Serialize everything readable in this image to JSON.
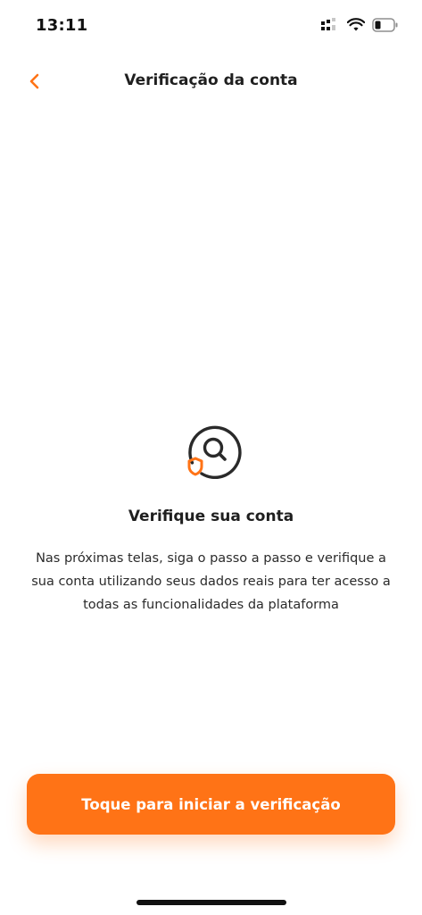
{
  "status_bar": {
    "time": "13:11",
    "icons": [
      "signal-icon",
      "wifi-icon",
      "battery-icon"
    ]
  },
  "header": {
    "title": "Verificação da conta",
    "back_icon": "chevron-left-icon"
  },
  "main": {
    "icon": "shield-search-icon",
    "title": "Verifique sua conta",
    "description": "Nas próximas telas, siga o passo a passo e verifique a sua conta utilizando seus dados reais para ter acesso a todas as funcionalidades da plataforma"
  },
  "cta": {
    "label": "Toque para iniciar a verificação"
  },
  "colors": {
    "accent": "#ff7316",
    "text": "#1f1f1f",
    "background": "#ffffff"
  }
}
